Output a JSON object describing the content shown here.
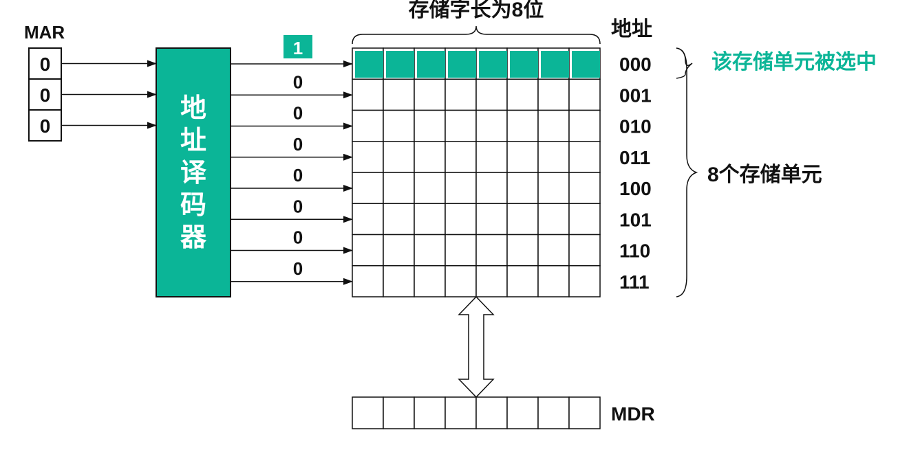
{
  "mar": {
    "label": "MAR",
    "bits": [
      "0",
      "0",
      "0"
    ]
  },
  "decoder": {
    "label": [
      "地",
      "址",
      "译",
      "码",
      "器"
    ]
  },
  "select_lines": [
    "1",
    "0",
    "0",
    "0",
    "0",
    "0",
    "0",
    "0"
  ],
  "word_length_label": "存储字长为8位",
  "address_header": "地址",
  "addresses": [
    "000",
    "001",
    "010",
    "011",
    "100",
    "101",
    "110",
    "111"
  ],
  "selected_note": "该存储单元被选中",
  "units_note": "8个存储单元",
  "mdr": {
    "label": "MDR"
  },
  "colors": {
    "accent": "#0bb597",
    "line": "#111111",
    "background": "#ffffff"
  }
}
